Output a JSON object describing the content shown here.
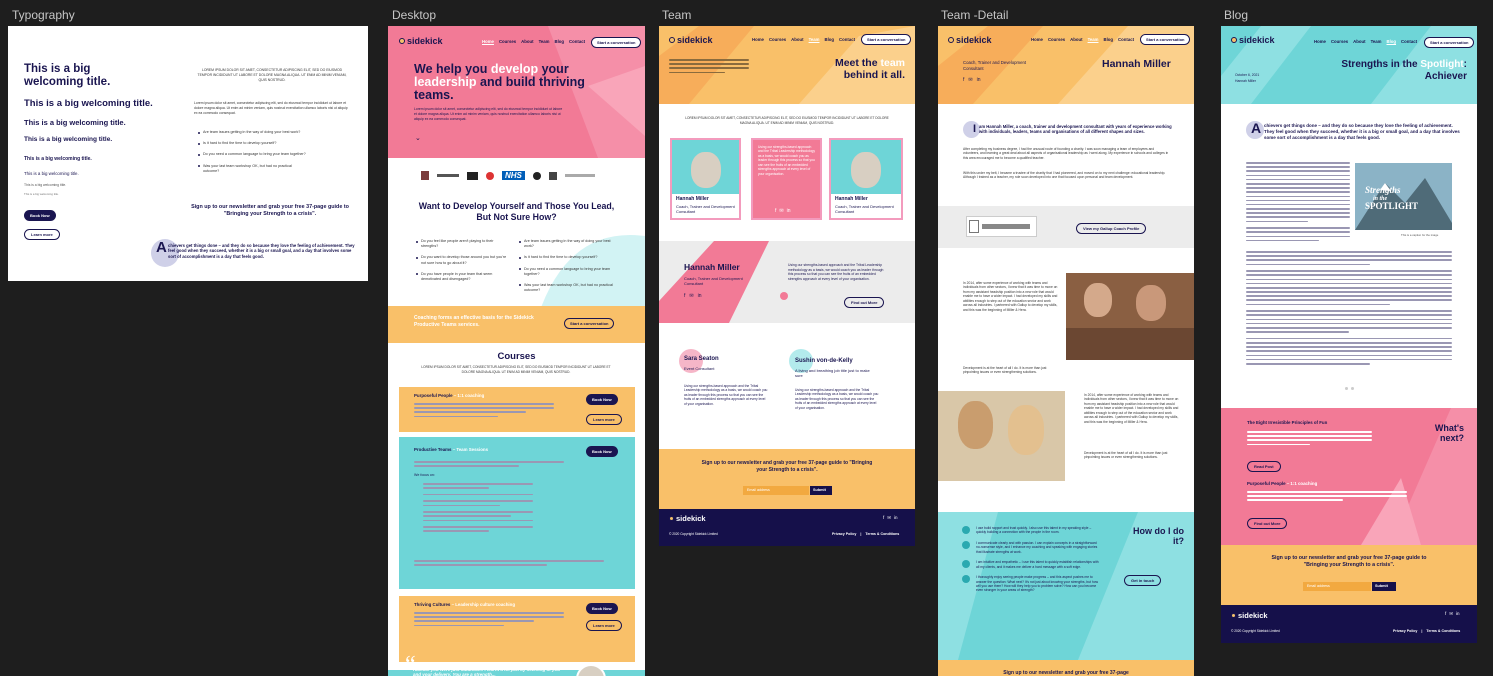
{
  "labels": {
    "typography": "Typography",
    "desktop": "Desktop",
    "team": "Team",
    "team_detail": "Team -Detail",
    "blog": "Blog"
  },
  "colors": {
    "canvas": "#1e1e1e",
    "pink": "#f27a96",
    "teal": "#6ed5d7",
    "orange": "#f9c069",
    "navy": "#15104a"
  },
  "nav": {
    "logo": "sidekick",
    "items": [
      "Home",
      "Courses",
      "About",
      "Team",
      "Blog",
      "Contact"
    ],
    "cta": "Start a conversation"
  },
  "typography": {
    "titles": [
      "This is a big welcoming title.",
      "This is a big welcoming title.",
      "This is a big welcoming title.",
      "This is a big welcoming title.",
      "This is a big welcoming title.",
      "This is a big welcoming title.",
      "This is a big welcoming title.",
      "This is a big welcoming title."
    ],
    "caps_text": "LOREM IPSUM DOLOR SIT AMET, CONSECTETUR ADIPISCING ELIT, SED DO EIUSMOD TEMPOR INCIDIDUNT UT LABORE ET DOLORE MAGNA ALIQUA. UT ENIM AD MINIM VENIAM, QUIS NOSTRUD.",
    "body_text": "Lorem ipsum dolor sit amet, consectetur adipiscing elit, sed do eiusmod tempor incididunt ut labore et dolore magna aliqua. Ut enim ad minim veniam, quis nostrud exercitation ullamco laboris nisi ut aliquip ex ea commodo consequat.",
    "bullets": [
      "Are team issues getting in the way of doing your best work?",
      "Is it hard to find the time to develop yourself?",
      "Do you need a common language to bring your team together?",
      "Was your last team workshop OK, but had no practical outcome?"
    ],
    "book_now": "Book Now",
    "learn_more": "Learn more",
    "newsletter": "Sign up to our newsletter and grab your free 37-page guide to \"Bringing your Strength to a crisis\".",
    "dropcap": "A",
    "dropcap_text": "chievers get things done – and they do so because they love the feeling of achievement. They feel good when they succeed, whether it is a big or small goal, and a day that involves some sort of accomplishment is a day that feels good."
  },
  "desktop": {
    "hero_title_a": "We help you ",
    "hero_title_b": "develop",
    "hero_title_c": " your ",
    "hero_title_d": "leadership",
    "hero_title_e": " and build thriving teams.",
    "hero_text": "Lorem ipsum dolor sit amet, consectetur adipiscing elit, sed do eiusmod tempor incididunt ut labore et dolore magna aliqua. Ut enim ad minim veniam, quis nostrud exercitation ullamco laboris nisi ut aliquip ex ea commodo consequat.",
    "logos": [
      "NHS"
    ],
    "section_title": "Want to Develop Yourself and Those You Lead, But Not Sure How?",
    "bullets_left": [
      "Do you feel like people aren't playing to their strengths?",
      "Do you want to develop those around you but you're not sure how to go about it?",
      "Do you have people in your team that seem demotivated and disengaged?"
    ],
    "bullets_right": [
      "Are team issues getting in the way of doing your best work?",
      "Is it hard to find the time to develop yourself?",
      "Do you need a common language to bring your team together?",
      "Was your last team workshop OK, but had no practical outcome?"
    ],
    "coaching_band": "Coaching forms an effective basis for the Sidekick Productive Teams services.",
    "courses_title": "Courses",
    "courses_caps": "LOREM IPSUM DOLOR SIT AMET, CONSECTETUR ADIPISCING ELIT, SED DO EIUSMOD TEMPOR INCIDIDUNT UT LABORE ET DOLORE MAGNA ALIQUA. UT ENIM AD MINIM VENIAM, QUIS NOSTRUD.",
    "course1_title": "Purposeful People",
    "course1_sub": " – 1:1 coaching",
    "course2_title": "Productive Teams",
    "course2_sub": " – Team Sessions",
    "course2_focus": "We focus on:",
    "course3_title": "Thriving Cultures",
    "course3_sub": " – Leadership culture coaching",
    "quote": "Hannah you were just fabulous... I learnt a lot just by listening to you and your delivery. You are a strength..."
  },
  "team": {
    "headline_a": "Meet the ",
    "headline_b": "team",
    "headline_c": " behind it all.",
    "caps": "LOREM IPSUM DOLOR SIT AMET, CONSECTETUR ADIPISCING ELIT, SED DO EIUSMOD TEMPOR INCIDIDUNT UT LABORE ET DOLORE MAGNA ALIQUA. UT ENIM AD MINIM VENIAM, QUIS NOSTRUD.",
    "card_name": "Hannah Miller",
    "card_role": "Coach, Trainer and Development Consultant",
    "pink_card_text": "Using our strengths-based approach and the Tribal Leadership methodology as a basis, we would coach you as leader through this process so that you can see the fruits of an embedded strengths approach at every level of your organisation.",
    "feature_name": "Hannah Miller",
    "feature_role": "Coach, Trainer and Development Consultant",
    "feature_text": "Using our strengths-based approach and the Tribal Leadership methodology as a basis, we would coach you as leader through this process so that you can see the fruits of an embedded strengths approach at every level of your organisation.",
    "find_out_more": "Find out More",
    "m1_name": "Sara Seaton",
    "m1_role": "Event Consultant",
    "m2_name": "Sushin von-de-Kelly",
    "m2_role": "A living and breathing job title just to make sure",
    "m_text": "Using our strengths-based approach and the Tribal Leadership methodology as a basis, we would coach you as leader through this process so that you can see the fruits of an embedded strengths approach at every level of your organisation.",
    "newsletter": "Sign up to our newsletter and grab your free 37-page guide to \"Bringing your Strength to a crisis\".",
    "email_placeholder": "Email address",
    "submit": "Submit",
    "copyright": "© 2020 Copyright Sidekick Limited",
    "privacy": "Privacy Policy",
    "terms": "Terms & Conditions"
  },
  "detail": {
    "role": "Coach, Trainer and Development Consultant",
    "name": "Hannah Miller",
    "intro_cap": "I",
    "intro": "am Hannah Miller, a coach, trainer and development consultant with years of experience working with individuals, leaders, teams and organisations of all different shapes and sizes.",
    "para1": "After completing my business degree, I had the unusual route of founding a charity. I was soon managing a team of employees and volunteers, and learning a great deal about all aspects of organisational leadership as I went along. My experience in schools and colleges in this area encouraged me to become a qualified teacher.",
    "para2": "With this under my belt, I became a trustee of the charity that I had pioneered, and moved on to my next challenge: educational leadership. Although I trained as a teacher, my role soon developed into one that focused upon personal and team development.",
    "gallup_button": "View my Gallup Coach Profile",
    "body1": "In 2014, after some experience of working with teams and individuals from other sectors, I knew that it was time to move on from my assistant headship position into a new role that would enable me to have a wider impact. I had developed my skills and abilities enough to step out of the education sector and work across all industries. I partnered with Gallup to develop my skills, and this was the beginning of Miller & Hera.",
    "body2": "Development is at the heart of all I do. It is more than just pinpointing issues or even strengthening solutions.",
    "how_title": "How do I do it?",
    "get_in_touch": "Get in touch",
    "how_items": [
      "I use build rapport and trust quickly. I also use this talent in my speaking style – quickly building a connection with the people in the room.",
      "I communicate clearly and with passion. I can explain concepts in a straightforward no-nonsense style, and I enhance my coaching and speaking with engaging stories that illustrate strengths at work.",
      "I am intuitive and empathetic – I use this talent to quickly establish relationships with all my clients, and it makes me deliver a hard message with a soft edge.",
      "I thoroughly enjoy seeing people make progress – and this aspect pushes me to answer the question: What next? It's not just about knowing your strengths, but how will you use them? How will they help you to problem solve? How can you become even stronger in your areas of strength?"
    ],
    "newsletter": "Sign up to our newsletter and grab your free 37-page"
  },
  "blog": {
    "date": "October 6, 2021",
    "author": "Hannah Miller",
    "title_a": "Strengths in the ",
    "title_b": "Spotlight",
    "title_c": ": Achiever",
    "dropcap": "A",
    "lead": "chievers get things done – and they do so because they love the feeling of achievement. They feel good when they succeed, whether it is a big or small goal, and a day that involves some sort of accomplishment is a day that feels good.",
    "book_text_a": "Strengths",
    "book_text_b": "in the",
    "book_text_c": "SPOTLIGHT",
    "caption": "This is a caption for the image",
    "whats_next": "What's next?",
    "next1_title": "The Eight Irresistible Principles of Fun",
    "next1_button": "Read Post",
    "next2_title": "Purposeful People",
    "next2_sub": " – 1:1 coaching",
    "next2_button": "Find out More",
    "newsletter": "Sign up to our newsletter and grab your free 37-page guide to \"Bringing your Strength to a crisis\".",
    "email_placeholder": "Email address",
    "submit": "Submit",
    "copyright": "© 2020 Copyright Sidekick Limited",
    "privacy": "Privacy Policy",
    "terms": "Terms & Conditions"
  }
}
